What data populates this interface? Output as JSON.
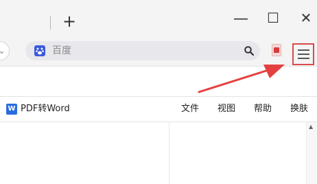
{
  "titlebar": {
    "new_tab_glyph": "+",
    "minimize_glyph": "—",
    "maximize_glyph": "☐",
    "close_glyph": "✕"
  },
  "addressbar": {
    "back_glyph": "⌄",
    "search_placeholder": "百度",
    "engine_icon": "baidu-paw-icon",
    "search_icon": "magnifier-icon",
    "extension_icon": "pdf-icon",
    "menu_icon": "hamburger-menu-icon",
    "highlight_color": "#d84a4a"
  },
  "app_toolbar": {
    "app_icon_letter": "W",
    "title": "PDF转Word",
    "menu": [
      "文件",
      "视图",
      "帮助",
      "换肤"
    ],
    "accent_color": "#2b6de0"
  },
  "annotation": {
    "arrow_color": "#e3413f"
  }
}
